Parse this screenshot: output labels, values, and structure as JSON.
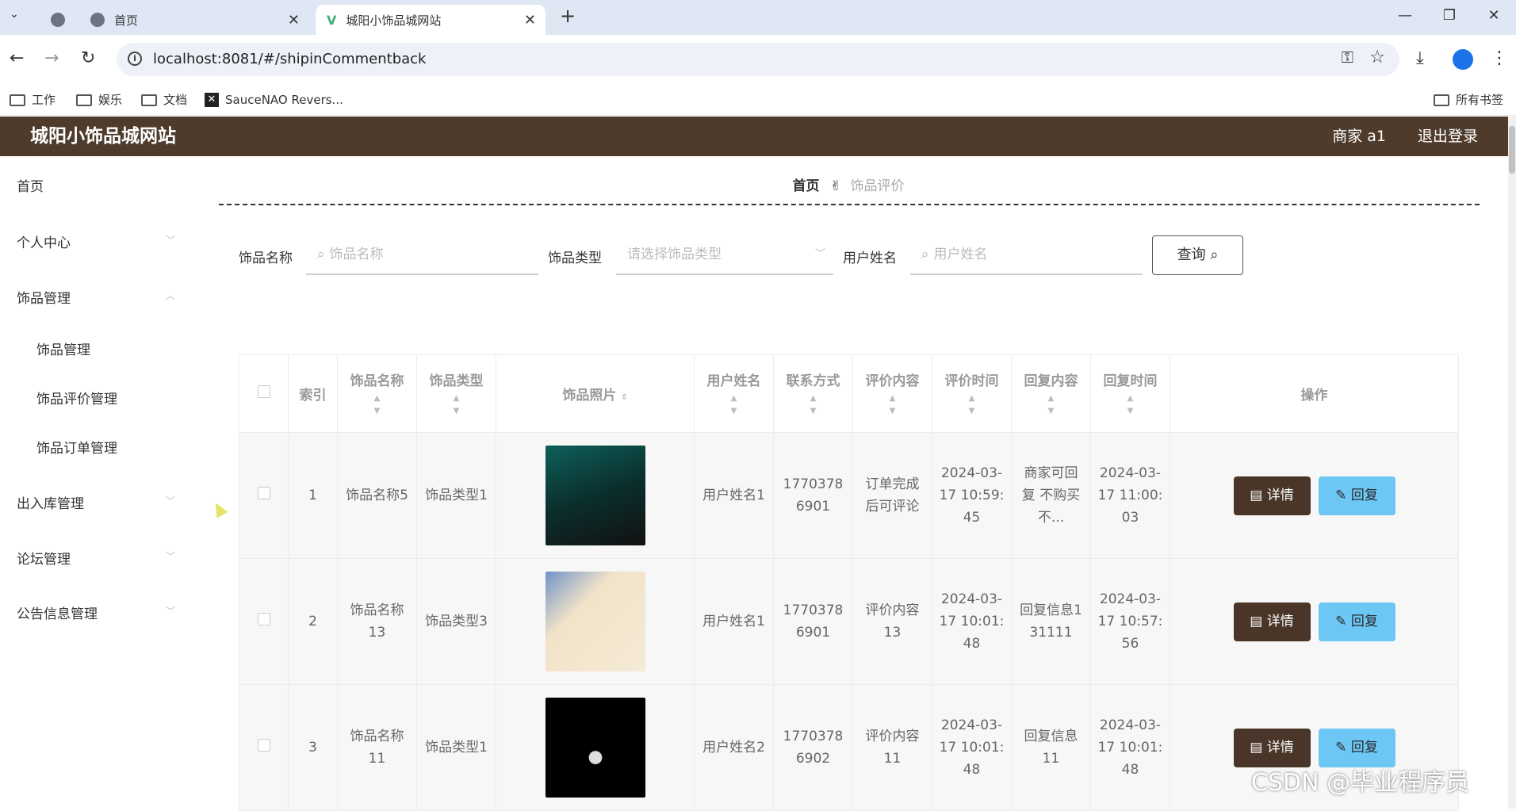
{
  "browser": {
    "tabs": [
      {
        "label": ""
      },
      {
        "label": "首页"
      },
      {
        "label": "城阳小饰品城网站"
      }
    ],
    "url": "localhost:8081/#/shipinCommentback",
    "bookmarks": [
      "工作",
      "娱乐",
      "文档",
      "SauceNAO Revers...",
      "所有书签"
    ]
  },
  "header": {
    "title": "城阳小饰品城网站",
    "user": "商家 a1",
    "logout": "退出登录"
  },
  "sidebar": {
    "items": [
      {
        "label": "首页"
      },
      {
        "label": "个人中心"
      },
      {
        "label": "饰品管理"
      },
      {
        "label": "饰品管理"
      },
      {
        "label": "饰品评价管理"
      },
      {
        "label": "饰品订单管理"
      },
      {
        "label": "出入库管理"
      },
      {
        "label": "论坛管理"
      },
      {
        "label": "公告信息管理"
      }
    ]
  },
  "breadcrumb": {
    "home": "首页",
    "current": "饰品评价"
  },
  "search": {
    "name_label": "饰品名称",
    "name_placeholder": "饰品名称",
    "type_label": "饰品类型",
    "type_placeholder": "请选择饰品类型",
    "user_label": "用户姓名",
    "user_placeholder": "用户姓名",
    "query": "查询"
  },
  "table": {
    "headers": [
      "索引",
      "饰品名称",
      "饰品类型",
      "饰品照片",
      "用户姓名",
      "联系方式",
      "评价内容",
      "评价时间",
      "回复内容",
      "回复时间",
      "操作"
    ],
    "rows": [
      {
        "index": "1",
        "name": "饰品名称5",
        "type": "饰品类型1",
        "user": "用户姓名1",
        "phone": "17703786901",
        "comment": "订单完成后可评论",
        "comment_time": "2024-03-17 10:59:45",
        "reply": "商家可回复 不购买不...",
        "reply_time": "2024-03-17 11:00:03"
      },
      {
        "index": "2",
        "name": "饰品名称13",
        "type": "饰品类型3",
        "user": "用户姓名1",
        "phone": "17703786901",
        "comment": "评价内容13",
        "comment_time": "2024-03-17 10:01:48",
        "reply": "回复信息131111",
        "reply_time": "2024-03-17 10:57:56"
      },
      {
        "index": "3",
        "name": "饰品名称11",
        "type": "饰品类型1",
        "user": "用户姓名2",
        "phone": "17703786902",
        "comment": "评价内容11",
        "comment_time": "2024-03-17 10:01:48",
        "reply": "回复信息11",
        "reply_time": "2024-03-17 10:01:48"
      }
    ],
    "detail": "详情",
    "reply": "回复"
  },
  "watermark": "CSDN @毕业程序员",
  "colors": {
    "header": "#4e3b2c",
    "detail_btn": "#4a3628",
    "reply_btn": "#6cc7f5"
  }
}
